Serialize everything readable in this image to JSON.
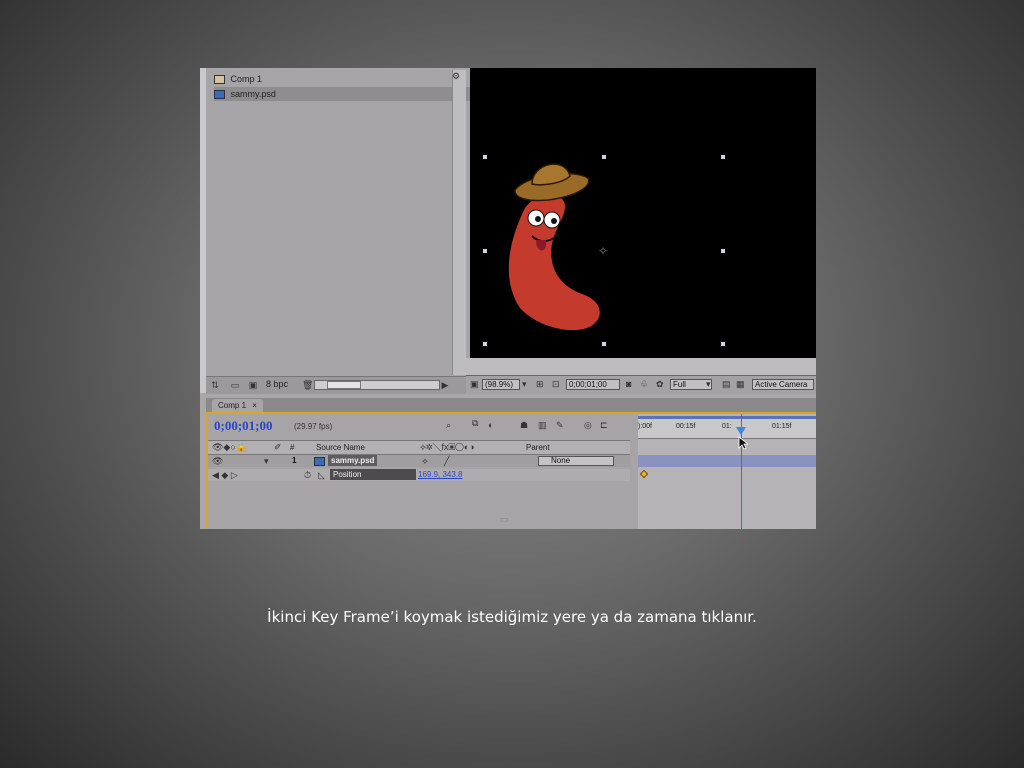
{
  "project": {
    "items": [
      {
        "label": "Comp 1",
        "icon": "composition-icon"
      },
      {
        "label": "sammy.psd",
        "icon": "psd-file-icon"
      }
    ],
    "bpc": "8 bpc"
  },
  "viewer": {
    "zoom": "(98.9%)",
    "timecode": "0;00;01;00",
    "resolution": "Full",
    "camera": "Active Camera"
  },
  "timeline": {
    "tab": "Comp 1",
    "timecode": "0;00;01;00",
    "fps": "(29.97 fps)",
    "columns": {
      "number": "#",
      "source_name": "Source Name",
      "parent": "Parent"
    },
    "layer": {
      "index": "1",
      "name": "sammy.psd",
      "parent": "None"
    },
    "property": {
      "name": "Position",
      "value": "169.9, 343.8"
    },
    "ruler": [
      "):00f",
      "00:15f",
      "01:",
      "01:15f"
    ]
  },
  "caption": "İkinci Key Frame’i koymak istediğimiz yere ya da zamana tıklanır.",
  "colors": {
    "timecode": "#2a46c8",
    "playhead": "#e03a2a",
    "keyframe": "#e7b52a",
    "panel_accent": "#d8a52a"
  }
}
